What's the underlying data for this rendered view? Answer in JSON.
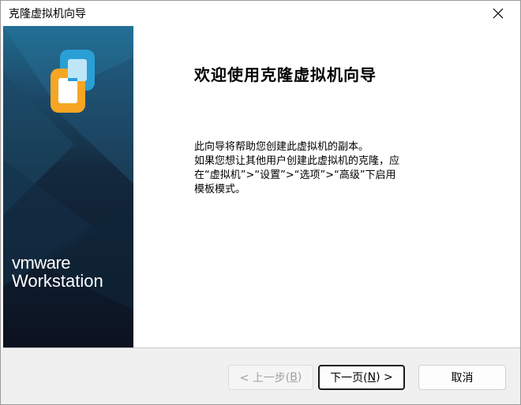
{
  "window": {
    "title": "克隆虚拟机向导"
  },
  "sidebar": {
    "brand_line1": "vmware",
    "brand_line2": "Workstation"
  },
  "content": {
    "heading": "欢迎使用克隆虚拟机向导",
    "paragraph1": "此向导将帮助您创建此虚拟机的副本。",
    "paragraph2": "如果您想让其他用户创建此虚拟机的克隆，应在“虚拟机”>“设置”>“选项”>“高级”下启用模板模式。"
  },
  "buttons": {
    "back": {
      "prefix": "< 上一步(",
      "key": "B",
      "suffix": ")"
    },
    "next": {
      "prefix": "下一页(",
      "key": "N",
      "suffix": ") >"
    },
    "cancel": "取消"
  }
}
